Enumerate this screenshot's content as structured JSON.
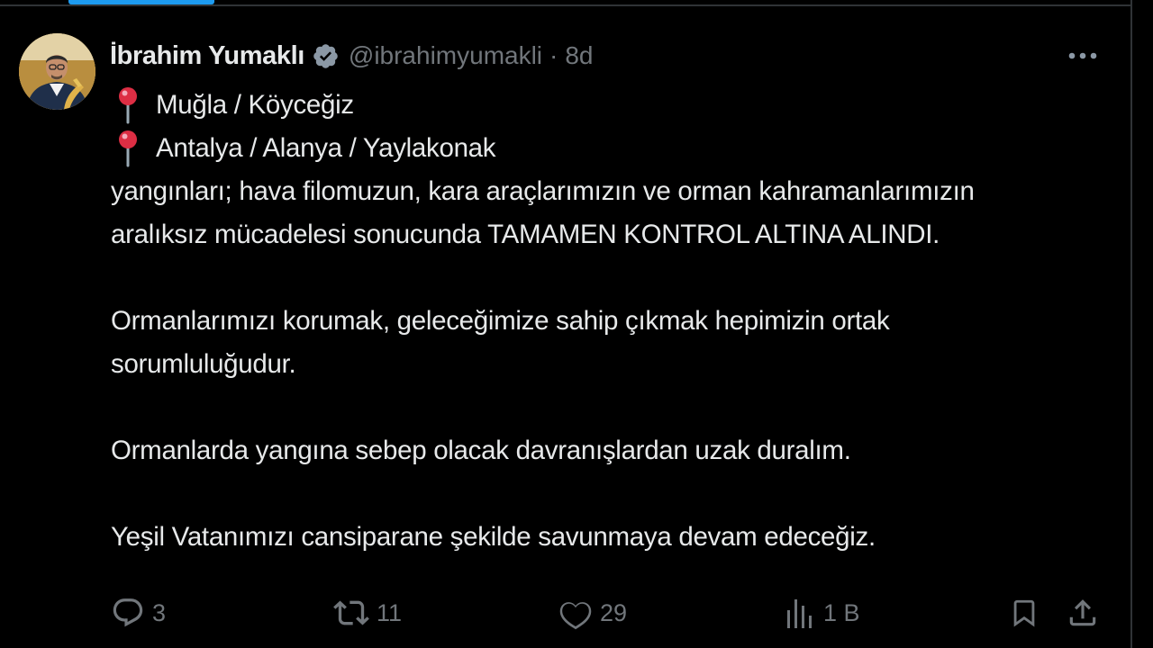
{
  "tweet": {
    "author_name": "İbrahim Yumaklı",
    "handle": "@ibrahimyumakli",
    "separator": "·",
    "time": "8d",
    "locations": [
      "Muğla / Köyceğiz",
      "Antalya / Alanya / Yaylakonak"
    ],
    "paragraphs": {
      "p1_line1": "yangınları; hava filomuzun, kara araçlarımızın ve orman kahramanlarımızın",
      "p1_line2": "aralıksız mücadelesi sonucunda TAMAMEN KONTROL ALTINA ALINDI.",
      "p2_line1": "Ormanlarımızı korumak, geleceğimize sahip çıkmak hepimizin ortak",
      "p2_line2": "sorumluluğudur.",
      "p3_line1": "Ormanlarda yangına sebep olacak davranışlardan uzak duralım.",
      "p4_line1": "Yeşil Vatanımızı cansiparane şekilde savunmaya devam edeceğiz."
    }
  },
  "actions": {
    "replies": "3",
    "reposts": "11",
    "likes": "29",
    "views": "1 B"
  },
  "icons": {
    "verified": "verified-badge-icon",
    "pin": "round-pushpin-icon",
    "more": "more-horizontal-icon",
    "reply": "reply-icon",
    "repost": "repost-icon",
    "like": "heart-icon",
    "views": "views-bar-chart-icon",
    "bookmark": "bookmark-icon",
    "share": "share-icon"
  },
  "colors": {
    "background": "#000000",
    "text": "#e7e9ea",
    "muted": "#71767b",
    "accent": "#1d9bf0",
    "pin_red": "#dd2e44"
  }
}
